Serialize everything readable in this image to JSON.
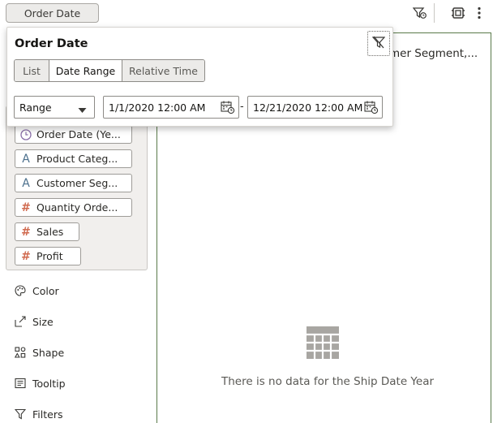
{
  "toolbar": {
    "filter_pill_label": "Order Date",
    "filter_icon": "filter-clock-icon",
    "settings_icon": "settings-icon",
    "more_icon": "more-vertical-icon"
  },
  "data_elements": [
    {
      "label": "Order Date (Ye...",
      "type": "date",
      "icon": "clock-icon"
    },
    {
      "label": "Product Categ...",
      "type": "text",
      "icon": "text-attribute-icon"
    },
    {
      "label": "Customer Seg...",
      "type": "text",
      "icon": "text-attribute-icon"
    },
    {
      "label": "Quantity Orde...",
      "type": "number",
      "icon": "number-icon"
    },
    {
      "label": "Sales",
      "type": "number",
      "icon": "number-icon"
    },
    {
      "label": "Profit",
      "type": "number",
      "icon": "number-icon"
    }
  ],
  "grammar": [
    {
      "label": "Color",
      "icon": "palette-icon"
    },
    {
      "label": "Size",
      "icon": "resize-icon"
    },
    {
      "label": "Shape",
      "icon": "shape-icon"
    },
    {
      "label": "Tooltip",
      "icon": "tooltip-icon"
    },
    {
      "label": "Filters",
      "icon": "filter-icon"
    }
  ],
  "canvas": {
    "title_fragment": "mer Segment,...",
    "no_data_text": "There is no data for the Ship Date Year"
  },
  "popup": {
    "title": "Order Date",
    "tabs": [
      "List",
      "Date Range",
      "Relative Time"
    ],
    "active_tab": "Date Range",
    "range_select_value": "Range",
    "start_date": "1/1/2020 12:00 AM",
    "end_date": "12/21/2020 12:00 AM",
    "separator": "-"
  },
  "colors": {
    "number_icon": "#d06a4f",
    "text_icon": "#4b6f8c",
    "canvas_border": "#5a7a4a"
  }
}
